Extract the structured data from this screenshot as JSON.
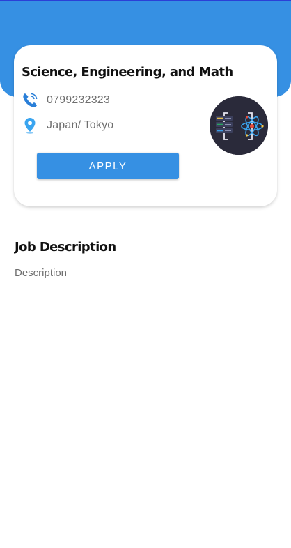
{
  "job": {
    "title": "Science, Engineering, and Math",
    "phone": "0799232323",
    "location": "Japan/ Tokyo",
    "apply_label": "APPLY",
    "logo_icon": "science-server-logo"
  },
  "description": {
    "heading": "Job Description",
    "text": "Description"
  },
  "colors": {
    "primary": "#3690e3",
    "status_bar": "#2b3fd6",
    "logo_bg": "#2a2a3a"
  }
}
